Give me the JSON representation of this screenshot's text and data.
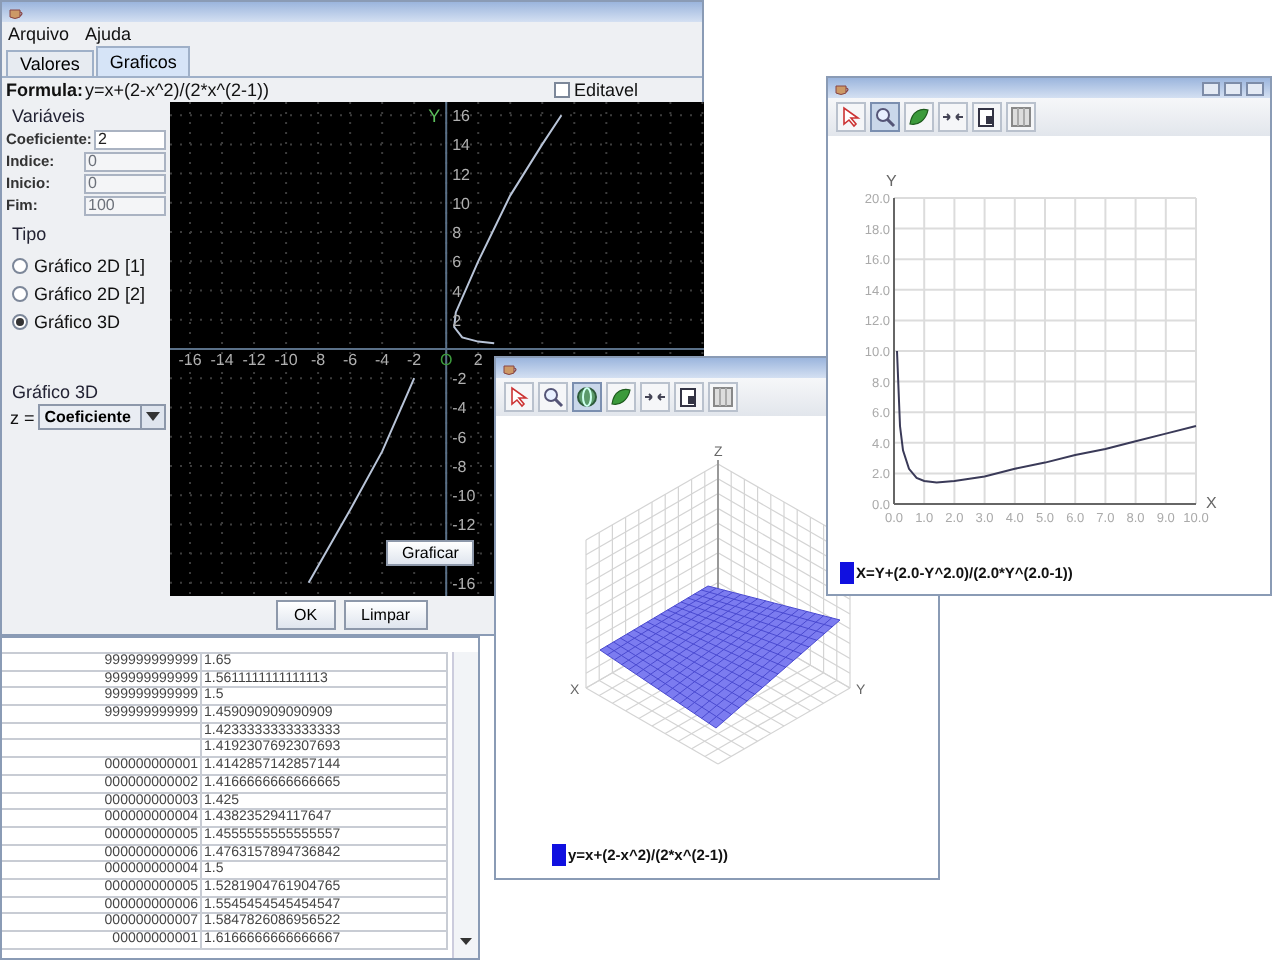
{
  "main_window": {
    "menu": [
      "Arquivo",
      "Ajuda"
    ],
    "tabs": [
      {
        "label": "Valores",
        "selected": false
      },
      {
        "label": "Graficos",
        "selected": true
      }
    ],
    "formula_label": "Formula:",
    "formula": "y=x+(2-x^2)/(2*x^(2-1))",
    "editable": {
      "label": "Editavel",
      "checked": false
    },
    "variables": {
      "title": "Variáveis",
      "fields": [
        {
          "label": "Coeficiente:",
          "value": "2",
          "disabled": false
        },
        {
          "label": "Indice:",
          "value": "0",
          "disabled": true
        },
        {
          "label": "Inicio:",
          "value": "0",
          "disabled": true
        },
        {
          "label": "Fim:",
          "value": "100",
          "disabled": true
        }
      ]
    },
    "type_group": {
      "title": "Tipo",
      "options": [
        {
          "label": "Gráfico 2D [1]",
          "selected": false
        },
        {
          "label": "Gráfico 2D [2]",
          "selected": false
        },
        {
          "label": "Gráfico 3D",
          "selected": true
        }
      ]
    },
    "group_3d": {
      "title": "Gráfico 3D",
      "axis_label": "z =",
      "dropdown": "Coeficiente"
    },
    "plot": {
      "chart_data": {
        "type": "line",
        "grid": true,
        "ylabel": "Y",
        "xlim": [
          -17.25,
          16.1
        ],
        "ylim": [
          -16.9,
          16.9
        ],
        "xticks": [
          -16,
          -14,
          -12,
          -10,
          -8,
          -6,
          -4,
          -2,
          {
            "value": 0,
            "label": "O"
          },
          2
        ],
        "yticks": [
          16,
          14,
          12,
          10,
          8,
          6,
          4,
          2,
          -2,
          -4,
          -6,
          -8,
          -10,
          -12,
          -16
        ],
        "x": [
          -8.6,
          -6,
          -4,
          -2.4,
          -2,
          0,
          3,
          2,
          1,
          0.5,
          0.6,
          2,
          4,
          6,
          7.2
        ],
        "series": [
          {
            "color": "#b8c4d8",
            "values": [
              -16,
              -11,
              -7,
              -3,
              -2,
              null,
              0.4,
              0.5,
              0.8,
              1.5,
              2.5,
              6,
              10.5,
              14,
              16
            ]
          }
        ]
      }
    },
    "plot_button": "Graficar",
    "buttons": [
      "OK",
      "Limpar"
    ]
  },
  "values_table": {
    "rows": [
      {
        "column_1": "999999999999",
        "column_2": "1.65"
      },
      {
        "column_1": "999999999999",
        "column_2": "1.5611111111111113"
      },
      {
        "column_1": "999999999999",
        "column_2": "1.5"
      },
      {
        "column_1": "999999999999",
        "column_2": "1.459090909090909"
      },
      {
        "column_2": "1.4233333333333333"
      },
      {
        "column_2": "1.4192307692307693"
      },
      {
        "column_1": "000000000001",
        "column_2": "1.4142857142857144"
      },
      {
        "column_1": "000000000002",
        "column_2": "1.4166666666666665"
      },
      {
        "column_1": "000000000003",
        "column_2": "1.425"
      },
      {
        "column_1": "000000000004",
        "column_2": "1.438235294117647"
      },
      {
        "column_1": "000000000005",
        "column_2": "1.4555555555555557"
      },
      {
        "column_1": "000000000006",
        "column_2": "1.4763157894736842"
      },
      {
        "column_1": "000000000004",
        "column_2": "1.5"
      },
      {
        "column_1": "000000000005",
        "column_2": "1.5281904761904765"
      },
      {
        "column_1": "000000000006",
        "column_2": "1.5545454545454547"
      },
      {
        "column_1": "000000000007",
        "column_2": "1.5847826086956522"
      },
      {
        "column_1": "00000000001",
        "column_2": "1.6166666666666667"
      }
    ]
  },
  "window_3d": {
    "toolbar": [
      {
        "kind": "cursor",
        "selected": false
      },
      {
        "kind": "zoom",
        "selected": false
      },
      {
        "kind": "rotate",
        "selected": true
      },
      {
        "kind": "leaf",
        "selected": false
      },
      {
        "kind": "arrows",
        "selected": false
      },
      {
        "kind": "save",
        "selected": false
      },
      {
        "kind": "grid",
        "selected": false
      }
    ],
    "axis_labels": [
      "Z",
      "X",
      "Y"
    ],
    "legend": "y=x+(2-x^2)/(2*x^(2-1))"
  },
  "window_2d": {
    "toolbar": [
      {
        "kind": "cursor",
        "selected": false
      },
      {
        "kind": "zoom",
        "selected": true
      },
      {
        "kind": "leaf",
        "selected": false
      },
      {
        "kind": "arrows",
        "selected": false
      },
      {
        "kind": "save",
        "selected": false
      },
      {
        "kind": "grid",
        "selected": false
      }
    ],
    "chart_data": {
      "type": "line",
      "grid": true,
      "xlabel": "X",
      "ylabel": "Y",
      "xlim": [
        0,
        10
      ],
      "ylim": [
        0,
        20
      ],
      "xticks": [
        {
          "value": 0,
          "label": "0.0"
        },
        {
          "value": 1,
          "label": "1.0"
        },
        {
          "value": 2,
          "label": "2.0"
        },
        {
          "value": 3,
          "label": "3.0"
        },
        {
          "value": 4,
          "label": "4.0"
        },
        {
          "value": 5,
          "label": "5.0"
        },
        {
          "value": 6,
          "label": "6.0"
        },
        {
          "value": 7,
          "label": "7.0"
        },
        {
          "value": 8,
          "label": "8.0"
        },
        {
          "value": 9,
          "label": "9.0"
        },
        {
          "value": 10,
          "label": "10.0"
        }
      ],
      "yticks": [
        {
          "value": 0,
          "label": "0.0"
        },
        {
          "value": 2,
          "label": "2.0"
        },
        {
          "value": 4,
          "label": "4.0"
        },
        {
          "value": 6,
          "label": "6.0"
        },
        {
          "value": 8,
          "label": "8.0"
        },
        {
          "value": 10,
          "label": "10.0"
        },
        {
          "value": 12,
          "label": "12.0"
        },
        {
          "value": 14,
          "label": "14.0"
        },
        {
          "value": 16,
          "label": "16.0"
        },
        {
          "value": 18,
          "label": "18.0"
        },
        {
          "value": 20,
          "label": "20.0"
        }
      ],
      "x": [
        0.1,
        0.2,
        0.3,
        0.5,
        0.75,
        1,
        1.41,
        2,
        3,
        4,
        5,
        6,
        7,
        8,
        9,
        10
      ],
      "series": [
        {
          "color": "#3a3a58",
          "values": [
            10,
            5.1,
            3.5,
            2.3,
            1.7,
            1.5,
            1.4,
            1.5,
            1.8,
            2.3,
            2.7,
            3.2,
            3.6,
            4.1,
            4.6,
            5.1
          ]
        }
      ]
    },
    "legend": "X=Y+(2.0-Y^2.0)/(2.0*Y^(2.0-1))"
  }
}
